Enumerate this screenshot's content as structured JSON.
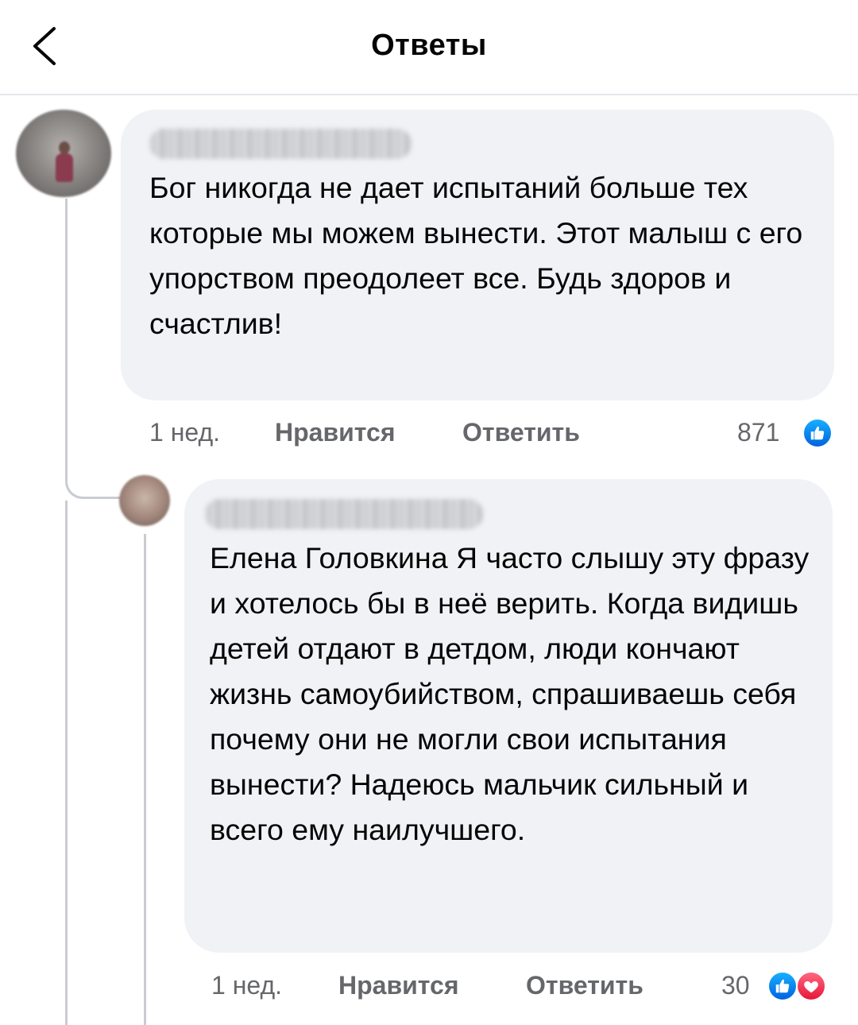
{
  "header": {
    "title": "Ответы"
  },
  "comments": [
    {
      "text": "Бог никогда не дает испытаний больше тех которые мы можем вынести. Этот малыш с его упорством преодолеет все. Будь здоров и счастлив!",
      "time": "1 нед.",
      "like_label": "Нравится",
      "reply_label": "Ответить",
      "reaction_count": "871",
      "reactions": [
        "like-icon"
      ]
    },
    {
      "text": "Елена Головкина Я часто слышу эту фразу и хотелось бы в неё верить. Когда видишь детей отдают в детдом, люди кончают жизнь самоубийством, спрашиваешь себя почему они не могли свои испытания вынести? Надеюсь мальчик сильный и всего ему наилучшего.",
      "time": "1 нед.",
      "like_label": "Нравится",
      "reply_label": "Ответить",
      "reaction_count": "30",
      "reactions": [
        "like-icon",
        "love-icon"
      ]
    }
  ],
  "colors": {
    "bubble_bg": "#f0f2f5",
    "secondary_text": "#65676b",
    "like_blue": "#1877f2",
    "love_red": "#f33e58"
  }
}
